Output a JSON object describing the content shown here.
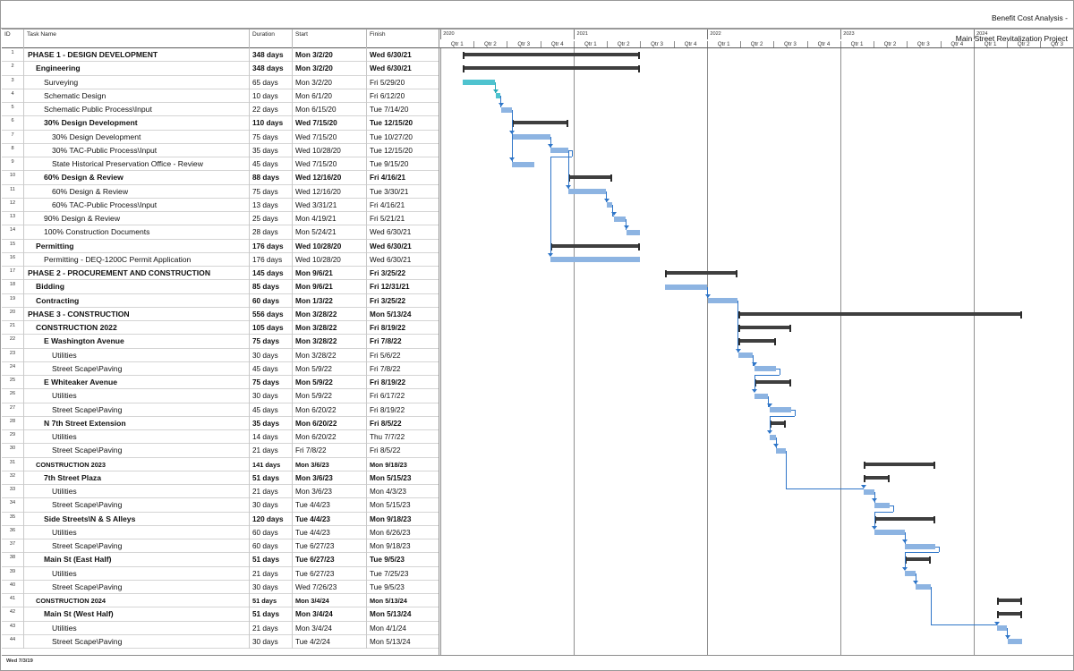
{
  "header": {
    "title_line1": "Benefit Cost Analysis -",
    "title_line2": "Main Street Revitalization Project"
  },
  "footer": {
    "date": "Wed 7/3/19"
  },
  "columns": {
    "id": "ID",
    "name": "Task Name",
    "duration": "Duration",
    "start": "Start",
    "finish": "Finish"
  },
  "timeline": {
    "start": "2019-12-29",
    "end": "2024-09-29",
    "years": [
      {
        "label": "2020",
        "start": "2020-01-01"
      },
      {
        "label": "2021",
        "start": "2021-01-01"
      },
      {
        "label": "2022",
        "start": "2022-01-01"
      },
      {
        "label": "2023",
        "start": "2023-01-01"
      },
      {
        "label": "2024",
        "start": "2024-01-01"
      }
    ],
    "quarters": [
      {
        "label": "Qtr 1",
        "start": "2020-01-01",
        "end": "2020-04-01"
      },
      {
        "label": "Qtr 2",
        "start": "2020-04-01",
        "end": "2020-07-01"
      },
      {
        "label": "Qtr 3",
        "start": "2020-07-01",
        "end": "2020-10-01"
      },
      {
        "label": "Qtr 4",
        "start": "2020-10-01",
        "end": "2021-01-01"
      },
      {
        "label": "Qtr 1",
        "start": "2021-01-01",
        "end": "2021-04-01"
      },
      {
        "label": "Qtr 2",
        "start": "2021-04-01",
        "end": "2021-07-01"
      },
      {
        "label": "Qtr 3",
        "start": "2021-07-01",
        "end": "2021-10-01"
      },
      {
        "label": "Qtr 4",
        "start": "2021-10-01",
        "end": "2022-01-01"
      },
      {
        "label": "Qtr 1",
        "start": "2022-01-01",
        "end": "2022-04-01"
      },
      {
        "label": "Qtr 2",
        "start": "2022-04-01",
        "end": "2022-07-01"
      },
      {
        "label": "Qtr 3",
        "start": "2022-07-01",
        "end": "2022-10-01"
      },
      {
        "label": "Qtr 4",
        "start": "2022-10-01",
        "end": "2023-01-01"
      },
      {
        "label": "Qtr 1",
        "start": "2023-01-01",
        "end": "2023-04-01"
      },
      {
        "label": "Qtr 2",
        "start": "2023-04-01",
        "end": "2023-07-01"
      },
      {
        "label": "Qtr 3",
        "start": "2023-07-01",
        "end": "2023-10-01"
      },
      {
        "label": "Qtr 4",
        "start": "2023-10-01",
        "end": "2024-01-01"
      },
      {
        "label": "Qtr 1",
        "start": "2024-01-01",
        "end": "2024-04-01"
      },
      {
        "label": "Qtr 2",
        "start": "2024-04-01",
        "end": "2024-07-01"
      },
      {
        "label": "Qtr 3",
        "start": "2024-07-01",
        "end": "2024-10-01"
      }
    ]
  },
  "colors": {
    "task_bar": "#8db4e2",
    "task_bar_alt": "#4fc3cf",
    "summary_bar": "#3f3f3f",
    "link": "#2e75c8",
    "grid": "#d8d8d8"
  },
  "tasks": [
    {
      "id": 1,
      "name": "PHASE 1 - DESIGN DEVELOPMENT",
      "duration": "348 days",
      "start": "Mon 3/2/20",
      "finish": "Wed 6/30/21",
      "indent": 0,
      "bold": true,
      "type": "summary",
      "s": "2020-03-02",
      "f": "2021-06-30"
    },
    {
      "id": 2,
      "name": "Engineering",
      "duration": "348 days",
      "start": "Mon 3/2/20",
      "finish": "Wed 6/30/21",
      "indent": 1,
      "bold": true,
      "type": "summary",
      "s": "2020-03-02",
      "f": "2021-06-30"
    },
    {
      "id": 3,
      "name": "Surveying",
      "duration": "65 days",
      "start": "Mon 3/2/20",
      "finish": "Fri 5/29/20",
      "indent": 2,
      "bold": false,
      "type": "task2",
      "s": "2020-03-02",
      "f": "2020-05-29"
    },
    {
      "id": 4,
      "name": "Schematic Design",
      "duration": "10 days",
      "start": "Mon 6/1/20",
      "finish": "Fri 6/12/20",
      "indent": 2,
      "bold": false,
      "type": "task2",
      "s": "2020-06-01",
      "f": "2020-06-12"
    },
    {
      "id": 5,
      "name": "Schematic Public Process\\Input",
      "duration": "22 days",
      "start": "Mon 6/15/20",
      "finish": "Tue 7/14/20",
      "indent": 2,
      "bold": false,
      "type": "task",
      "s": "2020-06-15",
      "f": "2020-07-14"
    },
    {
      "id": 6,
      "name": "30% Design Development",
      "duration": "110 days",
      "start": "Wed 7/15/20",
      "finish": "Tue 12/15/20",
      "indent": 2,
      "bold": true,
      "type": "summary",
      "s": "2020-07-15",
      "f": "2020-12-15"
    },
    {
      "id": 7,
      "name": "30% Design Development",
      "duration": "75 days",
      "start": "Wed 7/15/20",
      "finish": "Tue 10/27/20",
      "indent": 3,
      "bold": false,
      "type": "task",
      "s": "2020-07-15",
      "f": "2020-10-27"
    },
    {
      "id": 8,
      "name": "30% TAC-Public Process\\Input",
      "duration": "35 days",
      "start": "Wed 10/28/20",
      "finish": "Tue 12/15/20",
      "indent": 3,
      "bold": false,
      "type": "task",
      "s": "2020-10-28",
      "f": "2020-12-15"
    },
    {
      "id": 9,
      "name": "State Historical Preservation Office - Review",
      "duration": "45 days",
      "start": "Wed 7/15/20",
      "finish": "Tue 9/15/20",
      "indent": 3,
      "bold": false,
      "type": "task",
      "s": "2020-07-15",
      "f": "2020-09-15"
    },
    {
      "id": 10,
      "name": "60% Design & Review",
      "duration": "88 days",
      "start": "Wed 12/16/20",
      "finish": "Fri 4/16/21",
      "indent": 2,
      "bold": true,
      "type": "summary",
      "s": "2020-12-16",
      "f": "2021-04-16"
    },
    {
      "id": 11,
      "name": "60% Design & Review",
      "duration": "75 days",
      "start": "Wed 12/16/20",
      "finish": "Tue 3/30/21",
      "indent": 3,
      "bold": false,
      "type": "task",
      "s": "2020-12-16",
      "f": "2021-03-30"
    },
    {
      "id": 12,
      "name": "60% TAC-Public Process\\Input",
      "duration": "13 days",
      "start": "Wed 3/31/21",
      "finish": "Fri 4/16/21",
      "indent": 3,
      "bold": false,
      "type": "task",
      "s": "2021-03-31",
      "f": "2021-04-16"
    },
    {
      "id": 13,
      "name": "90% Design & Review",
      "duration": "25 days",
      "start": "Mon 4/19/21",
      "finish": "Fri 5/21/21",
      "indent": 2,
      "bold": false,
      "type": "task",
      "s": "2021-04-19",
      "f": "2021-05-21"
    },
    {
      "id": 14,
      "name": "100% Construction Documents",
      "duration": "28 days",
      "start": "Mon 5/24/21",
      "finish": "Wed 6/30/21",
      "indent": 2,
      "bold": false,
      "type": "task",
      "s": "2021-05-24",
      "f": "2021-06-30"
    },
    {
      "id": 15,
      "name": "Permitting",
      "duration": "176 days",
      "start": "Wed 10/28/20",
      "finish": "Wed 6/30/21",
      "indent": 1,
      "bold": true,
      "type": "summary",
      "s": "2020-10-28",
      "f": "2021-06-30"
    },
    {
      "id": 16,
      "name": "Permitting - DEQ-1200C Permit Application",
      "duration": "176 days",
      "start": "Wed 10/28/20",
      "finish": "Wed 6/30/21",
      "indent": 2,
      "bold": false,
      "type": "task",
      "s": "2020-10-28",
      "f": "2021-06-30"
    },
    {
      "id": 17,
      "name": "PHASE 2 - PROCUREMENT AND CONSTRUCTION",
      "duration": "145 days",
      "start": "Mon 9/6/21",
      "finish": "Fri 3/25/22",
      "indent": 0,
      "bold": true,
      "type": "summary",
      "s": "2021-09-06",
      "f": "2022-03-25"
    },
    {
      "id": 18,
      "name": "Bidding",
      "duration": "85 days",
      "start": "Mon 9/6/21",
      "finish": "Fri 12/31/21",
      "indent": 1,
      "bold": true,
      "type": "task",
      "s": "2021-09-06",
      "f": "2021-12-31"
    },
    {
      "id": 19,
      "name": "Contracting",
      "duration": "60 days",
      "start": "Mon 1/3/22",
      "finish": "Fri 3/25/22",
      "indent": 1,
      "bold": true,
      "type": "task",
      "s": "2022-01-03",
      "f": "2022-03-25"
    },
    {
      "id": 20,
      "name": "PHASE 3 - CONSTRUCTION",
      "duration": "556 days",
      "start": "Mon 3/28/22",
      "finish": "Mon 5/13/24",
      "indent": 0,
      "bold": true,
      "type": "summary",
      "s": "2022-03-28",
      "f": "2024-05-13"
    },
    {
      "id": 21,
      "name": "CONSTRUCTION 2022",
      "duration": "105 days",
      "start": "Mon 3/28/22",
      "finish": "Fri 8/19/22",
      "indent": 1,
      "bold": true,
      "type": "summary",
      "s": "2022-03-28",
      "f": "2022-08-19"
    },
    {
      "id": 22,
      "name": "E Washington Avenue",
      "duration": "75 days",
      "start": "Mon 3/28/22",
      "finish": "Fri 7/8/22",
      "indent": 2,
      "bold": true,
      "type": "summary",
      "s": "2022-03-28",
      "f": "2022-07-08"
    },
    {
      "id": 23,
      "name": "Utilities",
      "duration": "30 days",
      "start": "Mon 3/28/22",
      "finish": "Fri 5/6/22",
      "indent": 3,
      "bold": false,
      "type": "task",
      "s": "2022-03-28",
      "f": "2022-05-06"
    },
    {
      "id": 24,
      "name": "Street Scape\\Paving",
      "duration": "45 days",
      "start": "Mon 5/9/22",
      "finish": "Fri 7/8/22",
      "indent": 3,
      "bold": false,
      "type": "task",
      "s": "2022-05-09",
      "f": "2022-07-08"
    },
    {
      "id": 25,
      "name": "E Whiteaker Avenue",
      "duration": "75 days",
      "start": "Mon 5/9/22",
      "finish": "Fri 8/19/22",
      "indent": 2,
      "bold": true,
      "type": "summary",
      "s": "2022-05-09",
      "f": "2022-08-19"
    },
    {
      "id": 26,
      "name": "Utilities",
      "duration": "30 days",
      "start": "Mon 5/9/22",
      "finish": "Fri 6/17/22",
      "indent": 3,
      "bold": false,
      "type": "task",
      "s": "2022-05-09",
      "f": "2022-06-17"
    },
    {
      "id": 27,
      "name": "Street Scape\\Paving",
      "duration": "45 days",
      "start": "Mon 6/20/22",
      "finish": "Fri 8/19/22",
      "indent": 3,
      "bold": false,
      "type": "task",
      "s": "2022-06-20",
      "f": "2022-08-19"
    },
    {
      "id": 28,
      "name": "N 7th Street Extension",
      "duration": "35 days",
      "start": "Mon 6/20/22",
      "finish": "Fri 8/5/22",
      "indent": 2,
      "bold": true,
      "type": "summary",
      "s": "2022-06-20",
      "f": "2022-08-05"
    },
    {
      "id": 29,
      "name": "Utilities",
      "duration": "14 days",
      "start": "Mon 6/20/22",
      "finish": "Thu 7/7/22",
      "indent": 3,
      "bold": false,
      "type": "task",
      "s": "2022-06-20",
      "f": "2022-07-07"
    },
    {
      "id": 30,
      "name": "Street Scape\\Paving",
      "duration": "21 days",
      "start": "Fri 7/8/22",
      "finish": "Fri 8/5/22",
      "indent": 3,
      "bold": false,
      "type": "task",
      "s": "2022-07-08",
      "f": "2022-08-05"
    },
    {
      "id": 31,
      "name": "CONSTRUCTION 2023",
      "duration": "141 days",
      "start": "Mon 3/6/23",
      "finish": "Mon 9/18/23",
      "indent": 1,
      "bold": true,
      "type": "summary",
      "s": "2023-03-06",
      "f": "2023-09-18",
      "small": true
    },
    {
      "id": 32,
      "name": "7th Street Plaza",
      "duration": "51 days",
      "start": "Mon 3/6/23",
      "finish": "Mon 5/15/23",
      "indent": 2,
      "bold": true,
      "type": "summary",
      "s": "2023-03-06",
      "f": "2023-05-15"
    },
    {
      "id": 33,
      "name": "Utilities",
      "duration": "21 days",
      "start": "Mon 3/6/23",
      "finish": "Mon 4/3/23",
      "indent": 3,
      "bold": false,
      "type": "task",
      "s": "2023-03-06",
      "f": "2023-04-03"
    },
    {
      "id": 34,
      "name": "Street Scape\\Paving",
      "duration": "30 days",
      "start": "Tue 4/4/23",
      "finish": "Mon 5/15/23",
      "indent": 3,
      "bold": false,
      "type": "task",
      "s": "2023-04-04",
      "f": "2023-05-15"
    },
    {
      "id": 35,
      "name": "Side Streets\\N & S Alleys",
      "duration": "120 days",
      "start": "Tue 4/4/23",
      "finish": "Mon 9/18/23",
      "indent": 2,
      "bold": true,
      "type": "summary",
      "s": "2023-04-04",
      "f": "2023-09-18"
    },
    {
      "id": 36,
      "name": "Utilities",
      "duration": "60 days",
      "start": "Tue 4/4/23",
      "finish": "Mon 6/26/23",
      "indent": 3,
      "bold": false,
      "type": "task",
      "s": "2023-04-04",
      "f": "2023-06-26"
    },
    {
      "id": 37,
      "name": "Street Scape\\Paving",
      "duration": "60 days",
      "start": "Tue 6/27/23",
      "finish": "Mon 9/18/23",
      "indent": 3,
      "bold": false,
      "type": "task",
      "s": "2023-06-27",
      "f": "2023-09-18"
    },
    {
      "id": 38,
      "name": "Main St (East Half)",
      "duration": "51 days",
      "start": "Tue 6/27/23",
      "finish": "Tue 9/5/23",
      "indent": 2,
      "bold": true,
      "type": "summary",
      "s": "2023-06-27",
      "f": "2023-09-05"
    },
    {
      "id": 39,
      "name": "Utilities",
      "duration": "21 days",
      "start": "Tue 6/27/23",
      "finish": "Tue 7/25/23",
      "indent": 3,
      "bold": false,
      "type": "task",
      "s": "2023-06-27",
      "f": "2023-07-25"
    },
    {
      "id": 40,
      "name": "Street Scape\\Paving",
      "duration": "30 days",
      "start": "Wed 7/26/23",
      "finish": "Tue 9/5/23",
      "indent": 3,
      "bold": false,
      "type": "task",
      "s": "2023-07-26",
      "f": "2023-09-05"
    },
    {
      "id": 41,
      "name": "CONSTRUCTION 2024",
      "duration": "51 days",
      "start": "Mon 3/4/24",
      "finish": "Mon 5/13/24",
      "indent": 1,
      "bold": true,
      "type": "summary",
      "s": "2024-03-04",
      "f": "2024-05-13",
      "small": true
    },
    {
      "id": 42,
      "name": "Main St (West Half)",
      "duration": "51 days",
      "start": "Mon 3/4/24",
      "finish": "Mon 5/13/24",
      "indent": 2,
      "bold": true,
      "type": "summary",
      "s": "2024-03-04",
      "f": "2024-05-13"
    },
    {
      "id": 43,
      "name": "Utilities",
      "duration": "21 days",
      "start": "Mon 3/4/24",
      "finish": "Mon 4/1/24",
      "indent": 3,
      "bold": false,
      "type": "task",
      "s": "2024-03-04",
      "f": "2024-04-01"
    },
    {
      "id": 44,
      "name": "Street Scape\\Paving",
      "duration": "30 days",
      "start": "Tue 4/2/24",
      "finish": "Mon 5/13/24",
      "indent": 3,
      "bold": false,
      "type": "task",
      "s": "2024-04-02",
      "f": "2024-05-13"
    }
  ],
  "links": [
    {
      "from": 3,
      "to": 4
    },
    {
      "from": 4,
      "to": 5
    },
    {
      "from": 5,
      "to": 7
    },
    {
      "from": 5,
      "to": 9
    },
    {
      "from": 7,
      "to": 8
    },
    {
      "from": 8,
      "to": 11
    },
    {
      "from": 8,
      "to": 16
    },
    {
      "from": 11,
      "to": 12
    },
    {
      "from": 12,
      "to": 13
    },
    {
      "from": 13,
      "to": 14
    },
    {
      "from": 18,
      "to": 19
    },
    {
      "from": 19,
      "to": 23
    },
    {
      "from": 23,
      "to": 24
    },
    {
      "from": 24,
      "to": 26
    },
    {
      "from": 26,
      "to": 27
    },
    {
      "from": 27,
      "to": 29
    },
    {
      "from": 29,
      "to": 30
    },
    {
      "from": 30,
      "to": 33
    },
    {
      "from": 33,
      "to": 34
    },
    {
      "from": 34,
      "to": 36
    },
    {
      "from": 36,
      "to": 37
    },
    {
      "from": 37,
      "to": 39
    },
    {
      "from": 39,
      "to": 40
    },
    {
      "from": 40,
      "to": 43
    },
    {
      "from": 43,
      "to": 44
    }
  ]
}
